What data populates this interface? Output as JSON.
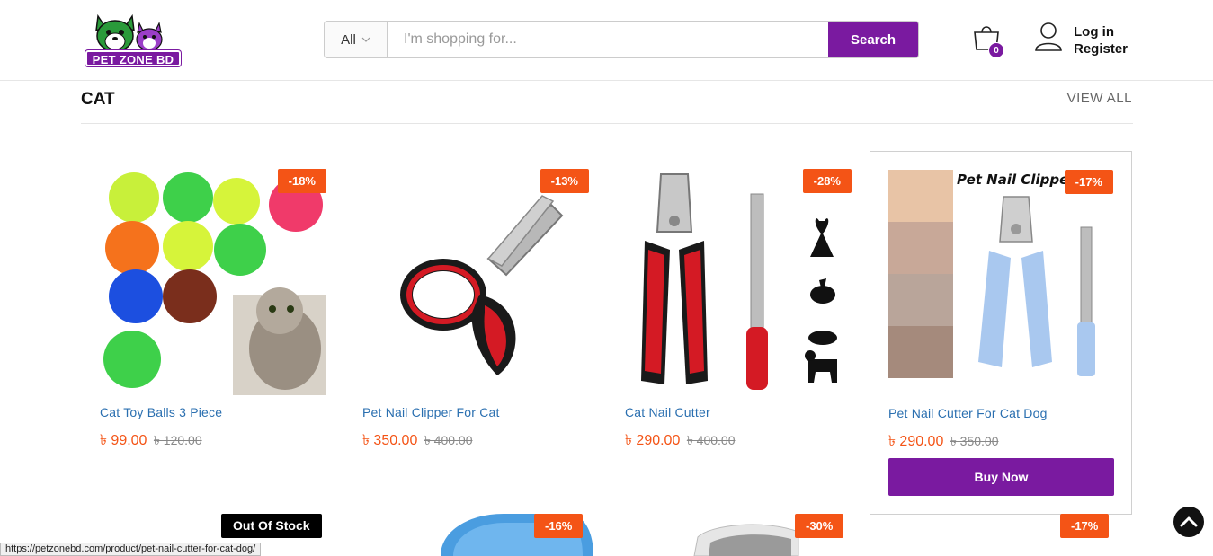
{
  "header": {
    "logo_text": "PET ZONE BD",
    "search_category": "All",
    "search_placeholder": "I'm shopping for...",
    "search_button": "Search",
    "cart_count": "0",
    "login_label": "Log in",
    "register_label": "Register"
  },
  "section": {
    "title": "CAT",
    "view_all": "VIEW ALL"
  },
  "products": [
    {
      "name": "Cat Toy Balls 3 Piece",
      "badge": "-18%",
      "price": "৳ 99.00",
      "old_price": "৳ 120.00"
    },
    {
      "name": "Pet Nail Clipper For Cat",
      "badge": "-13%",
      "price": "৳ 350.00",
      "old_price": "৳ 400.00"
    },
    {
      "name": "Cat Nail Cutter",
      "badge": "-28%",
      "price": "৳ 290.00",
      "old_price": "৳ 400.00"
    },
    {
      "name": "Pet Nail Cutter For Cat Dog",
      "badge": "-17%",
      "price": "৳ 290.00",
      "old_price": "৳ 350.00",
      "image_caption": "Pet Nail Clipper",
      "buy_label": "Buy Now"
    }
  ],
  "row2_badges": [
    "Out Of Stock",
    "-16%",
    "-30%",
    "-17%"
  ],
  "status_url": "https://petzonebd.com/product/pet-nail-cutter-for-cat-dog/",
  "colors": {
    "brand": "#7a1aa0",
    "discount": "#f45416",
    "link": "#2a6fb0"
  }
}
